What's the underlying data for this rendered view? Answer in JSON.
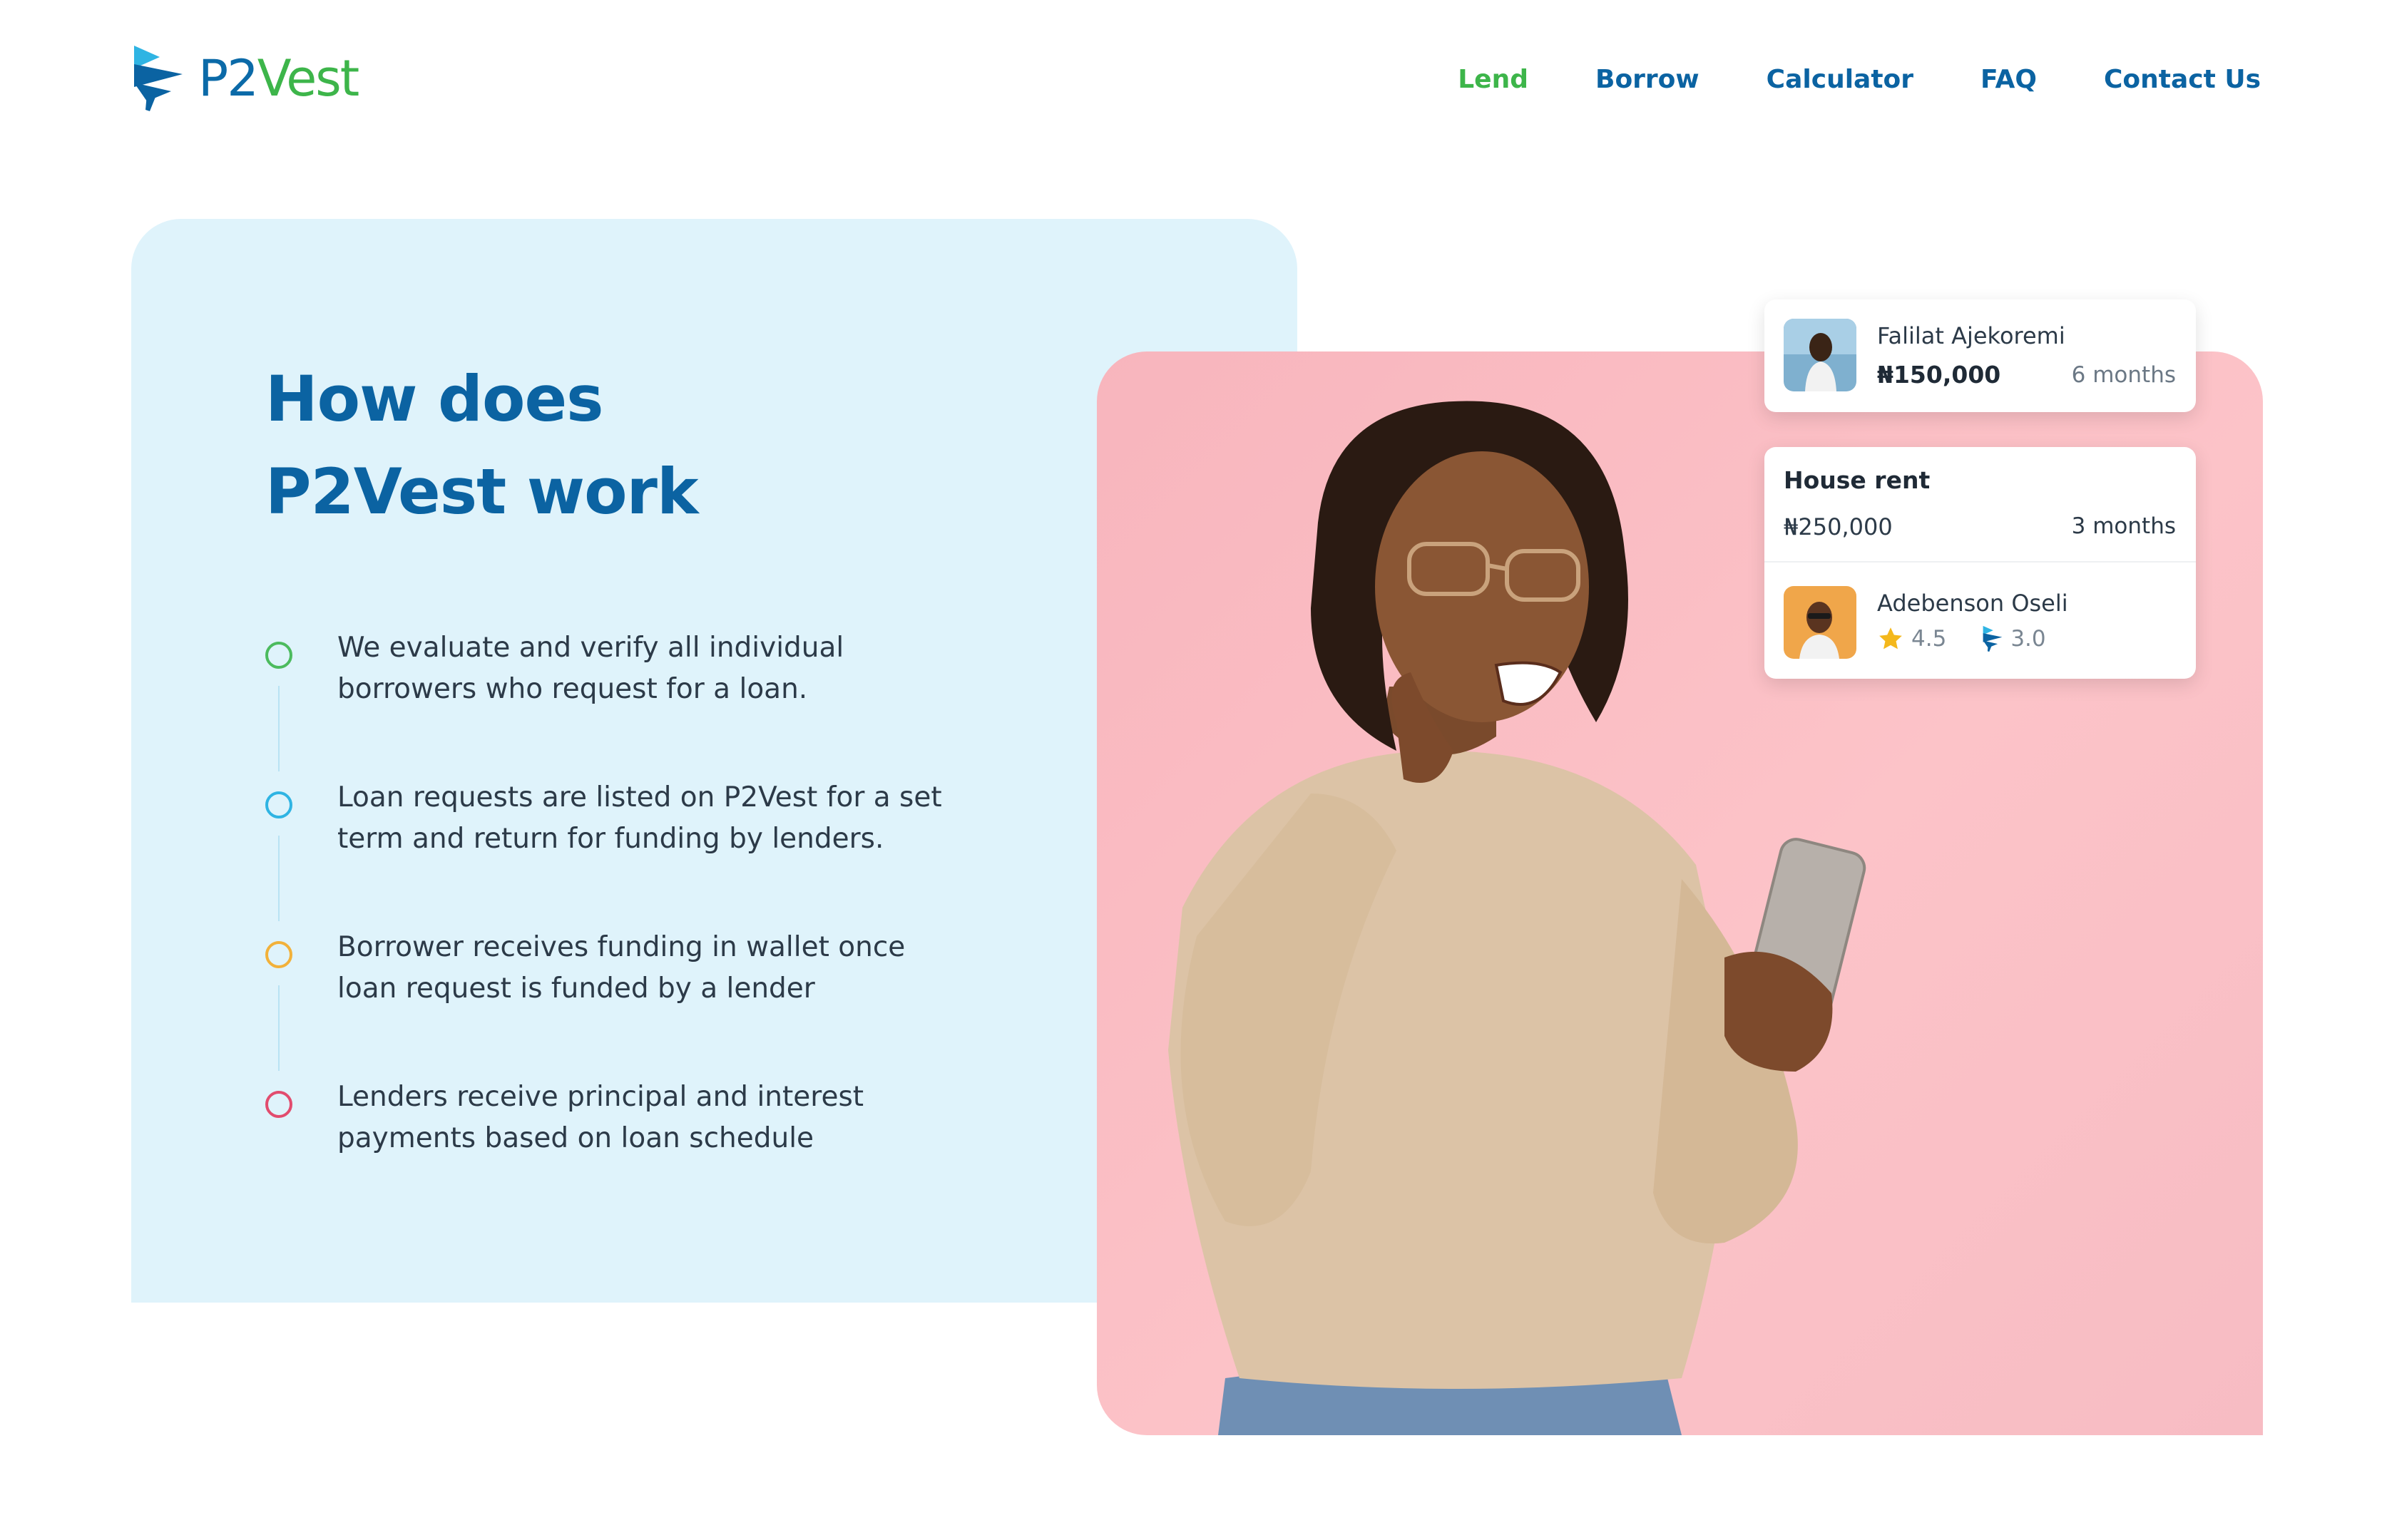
{
  "brand": {
    "name_prefix": "P2",
    "name_suffix": "Vest",
    "logo_icon": "p2vest-logo-icon"
  },
  "nav": {
    "items": [
      {
        "label": "Lend",
        "active": true
      },
      {
        "label": "Borrow",
        "active": false
      },
      {
        "label": "Calculator",
        "active": false
      },
      {
        "label": "FAQ",
        "active": false
      },
      {
        "label": "Contact Us",
        "active": false
      }
    ]
  },
  "section": {
    "title_line1": "How does",
    "title_line2": "P2Vest work",
    "steps": [
      {
        "text": "We evaluate and verify all individual borrowers who request for a loan.",
        "color": "#4cbb5e"
      },
      {
        "text": "Loan requests are listed on P2Vest for a set term and return for funding by lenders.",
        "color": "#2fb4e3"
      },
      {
        "text": "Borrower receives funding in wallet once loan request is funded by a lender",
        "color": "#f2b13a"
      },
      {
        "text": "Lenders receive principal and interest payments based on loan schedule",
        "color": "#e24c6e"
      }
    ]
  },
  "card_loan": {
    "name": "Falilat Ajekoremi",
    "amount": "₦150,000",
    "term": "6 months"
  },
  "card_request": {
    "title": "House rent",
    "amount": "₦250,000",
    "term": "3 months",
    "name": "Adebenson Oseli",
    "star_rating": "4.5",
    "p2vest_rating": "3.0",
    "star_icon": "star-icon",
    "p2vest_icon": "p2vest-mini-icon"
  },
  "colors": {
    "brand_blue": "#0b63a2",
    "brand_green": "#3db54a",
    "panel_blue": "#dff3fb",
    "panel_pink": "#f8b5bd"
  }
}
